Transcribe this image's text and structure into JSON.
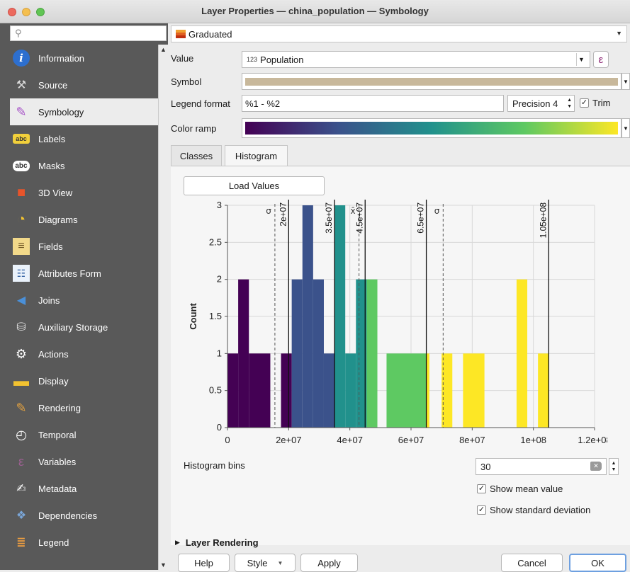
{
  "window": {
    "title": "Layer Properties — china_population — Symbology"
  },
  "sidebar": {
    "search_placeholder": "",
    "items": [
      {
        "label": "Information",
        "icon": "info-icon",
        "active": false
      },
      {
        "label": "Source",
        "icon": "source-icon",
        "active": false
      },
      {
        "label": "Symbology",
        "icon": "symbology-brush-icon",
        "active": true
      },
      {
        "label": "Labels",
        "icon": "labels-icon",
        "active": false
      },
      {
        "label": "Masks",
        "icon": "masks-icon",
        "active": false
      },
      {
        "label": "3D View",
        "icon": "cube-icon",
        "active": false
      },
      {
        "label": "Diagrams",
        "icon": "diagrams-icon",
        "active": false
      },
      {
        "label": "Fields",
        "icon": "fields-icon",
        "active": false
      },
      {
        "label": "Attributes Form",
        "icon": "form-icon",
        "active": false
      },
      {
        "label": "Joins",
        "icon": "joins-icon",
        "active": false
      },
      {
        "label": "Auxiliary Storage",
        "icon": "database-icon",
        "active": false
      },
      {
        "label": "Actions",
        "icon": "gear-icon",
        "active": false
      },
      {
        "label": "Display",
        "icon": "speech-bubble-icon",
        "active": false
      },
      {
        "label": "Rendering",
        "icon": "paintbrush-icon",
        "active": false
      },
      {
        "label": "Temporal",
        "icon": "clock-icon",
        "active": false
      },
      {
        "label": "Variables",
        "icon": "epsilon-icon",
        "active": false
      },
      {
        "label": "Metadata",
        "icon": "metadata-icon",
        "active": false
      },
      {
        "label": "Dependencies",
        "icon": "dependencies-icon",
        "active": false
      },
      {
        "label": "Legend",
        "icon": "legend-icon",
        "active": false
      }
    ]
  },
  "renderer": {
    "value": "Graduated"
  },
  "form": {
    "value_label": "Value",
    "value_prefix": "123",
    "value_field": "Population",
    "expression_symbol": "ε",
    "symbol_label": "Symbol",
    "symbol_color": "#c8b89b",
    "legend_format_label": "Legend format",
    "legend_format_value": "%1 - %2",
    "precision_value": "Precision 4",
    "trim_label": "Trim",
    "trim_checked": true,
    "color_ramp_label": "Color ramp"
  },
  "tabs": [
    {
      "label": "Classes",
      "active": false
    },
    {
      "label": "Histogram",
      "active": true
    }
  ],
  "histogram": {
    "load_values_label": "Load Values",
    "bins_label": "Histogram bins",
    "bins_value": "30",
    "show_mean_label": "Show mean value",
    "show_mean_checked": true,
    "show_std_label": "Show standard deviation",
    "show_std_checked": true
  },
  "chart_data": {
    "type": "bar",
    "ylabel": "Count",
    "xlim": [
      0,
      120000000
    ],
    "ylim": [
      0,
      3
    ],
    "x_ticks": [
      "0",
      "2e+07",
      "4e+07",
      "6e+07",
      "8e+07",
      "1e+08",
      "1.2e+08"
    ],
    "x_tick_values": [
      0,
      20000000,
      40000000,
      60000000,
      80000000,
      100000000,
      120000000
    ],
    "y_ticks": [
      "0",
      "0.5",
      "1",
      "1.5",
      "2",
      "2.5",
      "3"
    ],
    "y_tick_values": [
      0,
      0.5,
      1,
      1.5,
      2,
      2.5,
      3
    ],
    "bars": [
      {
        "x0": 0,
        "x1": 3500000,
        "count": 1,
        "color": "#440154"
      },
      {
        "x0": 3500000,
        "x1": 7000000,
        "count": 2,
        "color": "#440154"
      },
      {
        "x0": 7000000,
        "x1": 14000000,
        "count": 1,
        "color": "#440154"
      },
      {
        "x0": 17500000,
        "x1": 21000000,
        "count": 1,
        "color": "#440154"
      },
      {
        "x0": 21000000,
        "x1": 24500000,
        "count": 2,
        "color": "#3b528b"
      },
      {
        "x0": 24500000,
        "x1": 28000000,
        "count": 3,
        "color": "#3b528b"
      },
      {
        "x0": 28000000,
        "x1": 31500000,
        "count": 2,
        "color": "#3b528b"
      },
      {
        "x0": 31500000,
        "x1": 35000000,
        "count": 1,
        "color": "#3b528b"
      },
      {
        "x0": 35000000,
        "x1": 38500000,
        "count": 3,
        "color": "#21918c"
      },
      {
        "x0": 38500000,
        "x1": 42000000,
        "count": 1,
        "color": "#21918c"
      },
      {
        "x0": 42000000,
        "x1": 45500000,
        "count": 2,
        "color": "#21918c"
      },
      {
        "x0": 45500000,
        "x1": 49000000,
        "count": 2,
        "color": "#5ec962"
      },
      {
        "x0": 52000000,
        "x1": 65000000,
        "count": 1,
        "color": "#5ec962"
      },
      {
        "x0": 65000000,
        "x1": 66000000,
        "count": 1,
        "color": "#fde725"
      },
      {
        "x0": 70000000,
        "x1": 73500000,
        "count": 1,
        "color": "#fde725"
      },
      {
        "x0": 77000000,
        "x1": 84000000,
        "count": 1,
        "color": "#fde725"
      },
      {
        "x0": 94500000,
        "x1": 98000000,
        "count": 2,
        "color": "#fde725"
      },
      {
        "x0": 101500000,
        "x1": 105000000,
        "count": 1,
        "color": "#fde725"
      }
    ],
    "class_breaks": [
      {
        "value": 20000000,
        "label": "2e+07"
      },
      {
        "value": 35000000,
        "label": "3.5e+07"
      },
      {
        "value": 45000000,
        "label": "4.5e+07"
      },
      {
        "value": 65000000,
        "label": "6.5e+07"
      },
      {
        "value": 105000000,
        "label": "1.05e+08"
      }
    ],
    "stat_lines": [
      {
        "value": 15500000,
        "label": "σ"
      },
      {
        "value": 43000000,
        "label": "x̄"
      },
      {
        "value": 70500000,
        "label": "σ"
      }
    ],
    "grid": true,
    "color_ramp": [
      "#440154",
      "#3b528b",
      "#21918c",
      "#5ec962",
      "#fde725"
    ]
  },
  "sections": {
    "layer_rendering_label": "Layer Rendering"
  },
  "footer": {
    "help_label": "Help",
    "style_label": "Style",
    "apply_label": "Apply",
    "cancel_label": "Cancel",
    "ok_label": "OK"
  }
}
